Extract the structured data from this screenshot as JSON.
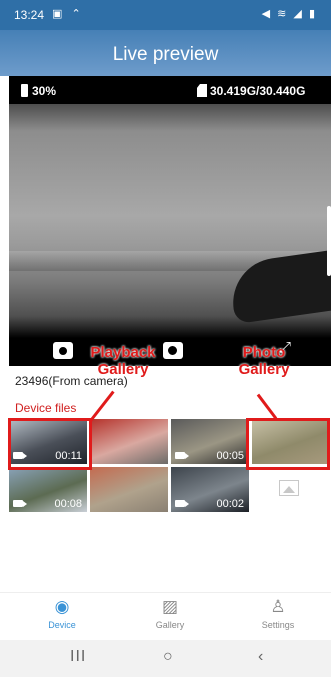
{
  "status_bar": {
    "time": "13:24",
    "left_icons": "▣ ⌃",
    "right_icons": "◀ ≋ ◢ ▮"
  },
  "header": {
    "title": "Live preview"
  },
  "preview": {
    "battery": "30%",
    "storage": "30.419G/30.440G",
    "expand_glyph": "⤢"
  },
  "annotations": {
    "playback": "Playback\nGallery",
    "photo": "Photo\nGallery"
  },
  "device": {
    "name": "23496(From camera)",
    "files_label": "Device files"
  },
  "thumbnails": [
    {
      "duration": "00:11",
      "colors": [
        "#b7c0c8",
        "#4a4f58",
        "#20242b"
      ]
    },
    {
      "duration": "",
      "colors": [
        "#b5322b",
        "#d9a8a0",
        "#6c6b68"
      ]
    },
    {
      "duration": "00:05",
      "colors": [
        "#5a5a5a",
        "#9b9684",
        "#2a2a2a"
      ]
    },
    {
      "duration": "",
      "colors": [
        "#c9c2a8",
        "#8f8a6a",
        "#a89a7e"
      ]
    },
    {
      "duration": "00:08",
      "colors": [
        "#8aa3ba",
        "#5c6b52",
        "#c9cfd6"
      ]
    },
    {
      "duration": "",
      "colors": [
        "#c46b50",
        "#b0a28c",
        "#8a8072"
      ]
    },
    {
      "duration": "00:02",
      "colors": [
        "#3d444c",
        "#7d858c",
        "#1c2026"
      ]
    }
  ],
  "bottom_nav": [
    {
      "label": "Device",
      "icon": "camera-icon",
      "glyph": "◉"
    },
    {
      "label": "Gallery",
      "icon": "gallery-icon",
      "glyph": "▨"
    },
    {
      "label": "Settings",
      "icon": "settings-icon",
      "glyph": "♙"
    }
  ],
  "system_nav": {
    "recents": "III",
    "home": "○",
    "back": "‹"
  },
  "colors": {
    "accent": "#3a93d6",
    "header": "#4a80b6",
    "annotation": "#e01b1b"
  }
}
